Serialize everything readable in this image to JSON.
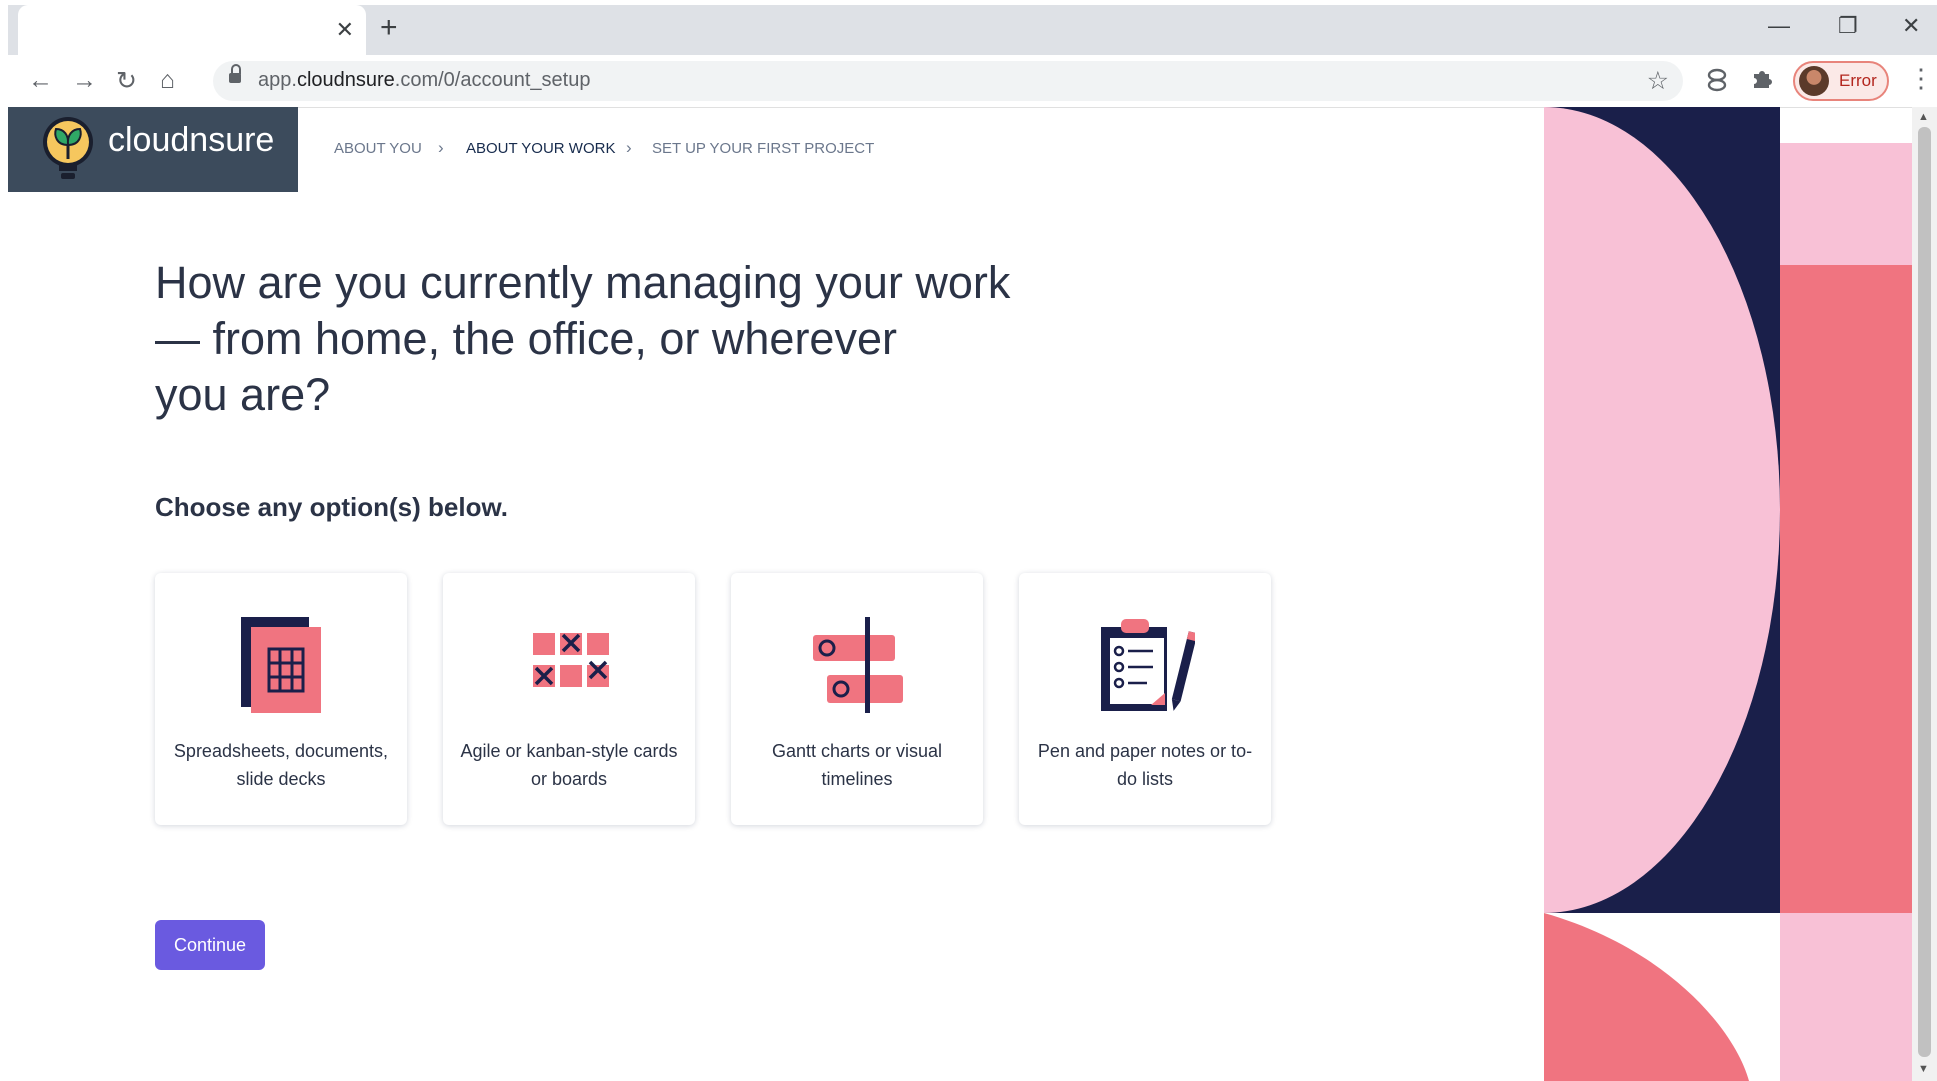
{
  "browser": {
    "tab_close": "✕",
    "new_tab": "+",
    "window_controls": {
      "minimize": "—",
      "restore": "❐",
      "close": "✕"
    },
    "url_prefix": "app.",
    "url_host": "cloudnsure",
    "url_path": ".com/0/account_setup",
    "profile_label": "Error"
  },
  "logo": {
    "text": "cloudnsure"
  },
  "breadcrumb": [
    {
      "label": "About you",
      "active": false
    },
    {
      "label": "About your work",
      "active": true
    },
    {
      "label": "Set up your first project",
      "active": false
    }
  ],
  "question": {
    "line1": "How are you currently managing your work",
    "line2": "— from home, the office, or wherever",
    "line3": "you are?"
  },
  "subheading": "Choose any option(s) below.",
  "options": [
    {
      "line1": "Spreadsheets, documents,",
      "line2": "slide decks",
      "icon": "spreadsheet-icon"
    },
    {
      "line1": "Agile or kanban-style cards",
      "line2": "or boards",
      "icon": "kanban-icon"
    },
    {
      "line1": "Gantt charts or visual",
      "line2": "timelines",
      "icon": "gantt-icon"
    },
    {
      "line1": "Pen and paper notes or to-",
      "line2": "do lists",
      "icon": "clipboard-icon"
    }
  ],
  "continue_label": "Continue",
  "colors": {
    "navy": "#1a1f4a",
    "pink": "#f8c1d6",
    "coral": "#f07480",
    "button": "#6a5ae0",
    "logo_bg": "#3c4b5c"
  }
}
